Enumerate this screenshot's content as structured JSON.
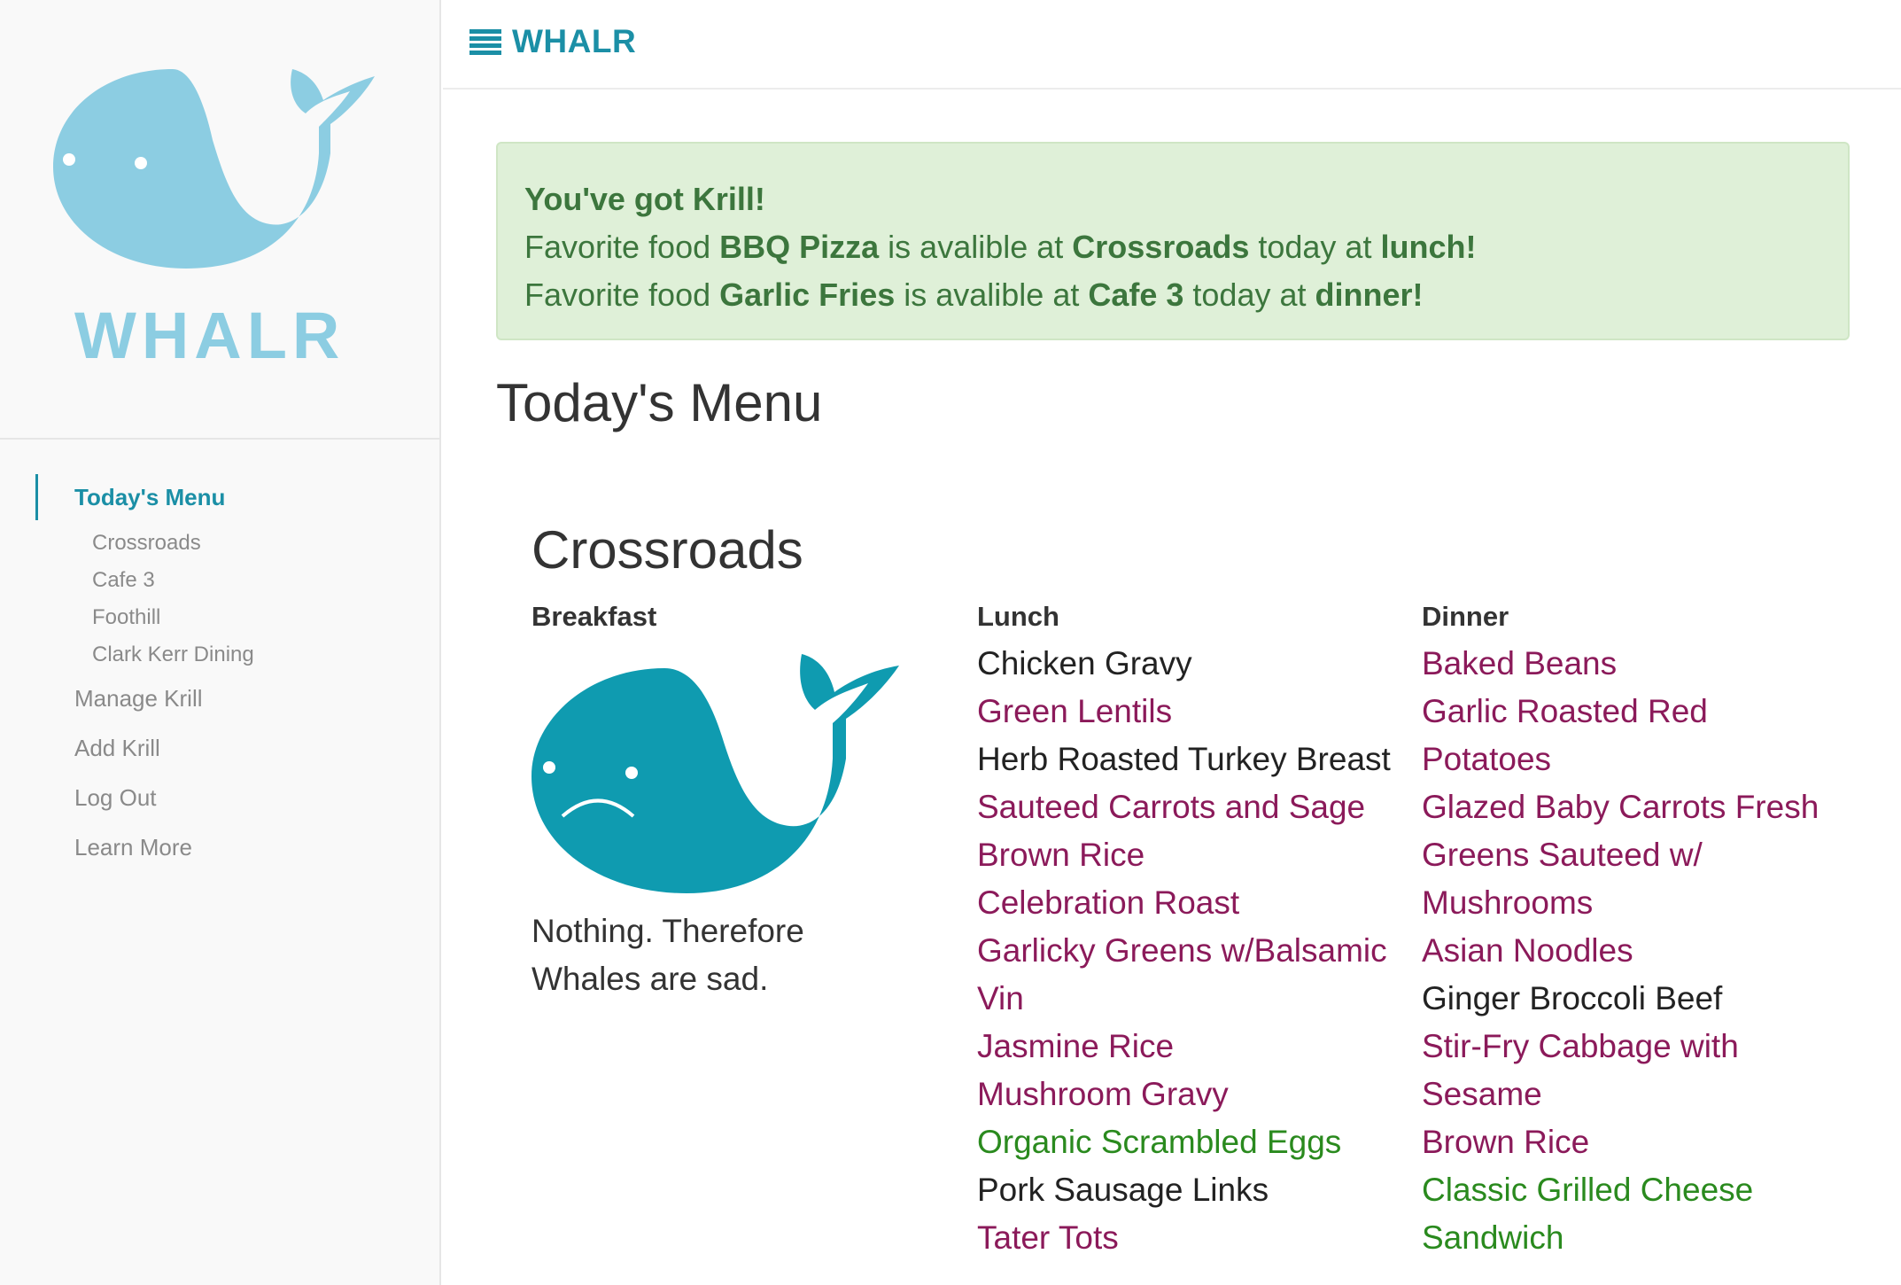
{
  "app": {
    "brand": "WHALR",
    "logo_text": "WHALR"
  },
  "colors": {
    "accent": "#1b8fa6",
    "logo": "#8ccde2",
    "alert_bg": "#dff0d8",
    "alert_text": "#3c763d",
    "unavailable": "#8b1a5a",
    "vegetarian": "#2a8a1e"
  },
  "sidebar": {
    "active": "Today's Menu",
    "subitems": [
      "Crossroads",
      "Cafe 3",
      "Foothill",
      "Clark Kerr Dining"
    ],
    "items": [
      "Manage Krill",
      "Add Krill",
      "Log Out",
      "Learn More"
    ]
  },
  "alert": {
    "title": "You've got Krill!",
    "lines": [
      {
        "p1": "Favorite food ",
        "food": "BBQ Pizza",
        "p2": " is avalible at ",
        "place": "Crossroads",
        "p3": " today at ",
        "meal": "lunch!"
      },
      {
        "p1": "Favorite food ",
        "food": "Garlic Fries",
        "p2": " is avalible at ",
        "place": "Cafe 3",
        "p3": " today at ",
        "meal": "dinner!"
      }
    ]
  },
  "page_title": "Today's Menu",
  "hall": {
    "name": "Crossroads",
    "breakfast": {
      "label": "Breakfast",
      "empty_text": "Nothing. Therefore Whales are sad."
    },
    "lunch": {
      "label": "Lunch",
      "items": [
        {
          "name": "Chicken Gravy",
          "style": "black"
        },
        {
          "name": "Green Lentils",
          "style": "purple"
        },
        {
          "name": "Herb Roasted Turkey Breast",
          "style": "black"
        },
        {
          "name": "Sauteed Carrots and Sage",
          "style": "purple"
        },
        {
          "name": "Brown Rice",
          "style": "purple"
        },
        {
          "name": "Celebration Roast",
          "style": "purple"
        },
        {
          "name": "Garlicky Greens w/Balsamic Vin",
          "style": "purple"
        },
        {
          "name": "Jasmine Rice",
          "style": "purple"
        },
        {
          "name": "Mushroom Gravy",
          "style": "purple"
        },
        {
          "name": "Organic Scrambled Eggs",
          "style": "green"
        },
        {
          "name": "Pork Sausage Links",
          "style": "black"
        },
        {
          "name": "Tater Tots",
          "style": "purple"
        }
      ]
    },
    "dinner": {
      "label": "Dinner",
      "items": [
        {
          "name": "Baked Beans",
          "style": "purple"
        },
        {
          "name": "Garlic Roasted Red Potatoes",
          "style": "purple"
        },
        {
          "name": "Glazed Baby Carrots Fresh",
          "style": "purple"
        },
        {
          "name": "Greens Sauteed w/ Mushrooms",
          "style": "purple"
        },
        {
          "name": "Asian Noodles",
          "style": "purple"
        },
        {
          "name": "Ginger Broccoli Beef",
          "style": "black"
        },
        {
          "name": "Stir-Fry Cabbage with Sesame",
          "style": "purple"
        },
        {
          "name": "Brown Rice",
          "style": "purple"
        },
        {
          "name": "Classic Grilled Cheese Sandwich",
          "style": "green"
        }
      ]
    }
  }
}
